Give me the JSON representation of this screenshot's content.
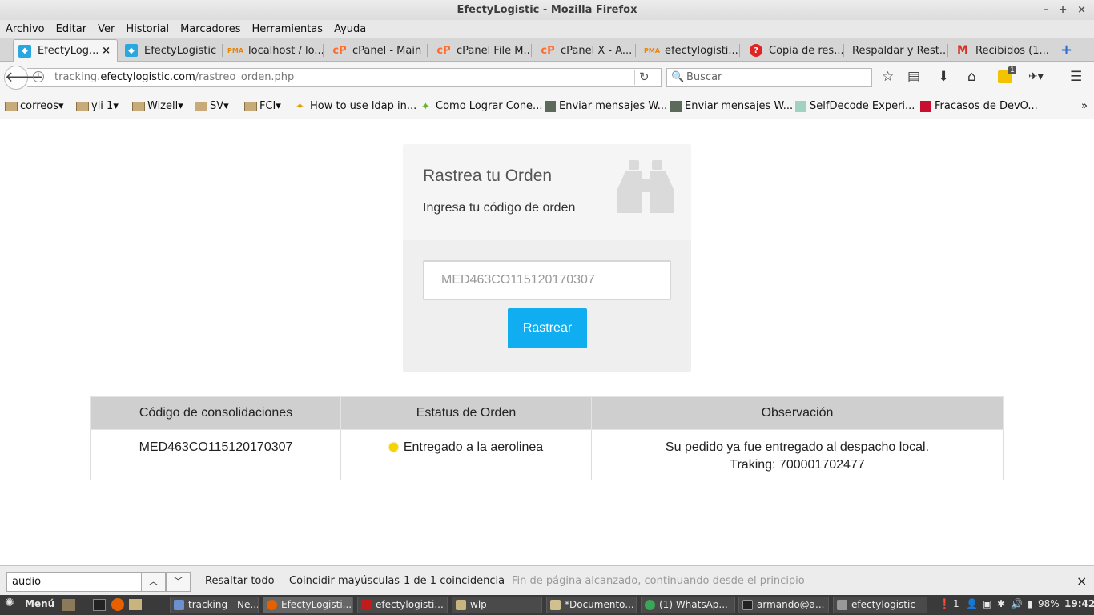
{
  "window": {
    "title": "EfectyLogistic - Mozilla Firefox",
    "controls": "– + ×"
  },
  "menu": [
    "Archivo",
    "Editar",
    "Ver",
    "Historial",
    "Marcadores",
    "Herramientas",
    "Ayuda"
  ],
  "tabs": [
    {
      "label": "EfectyLog...",
      "close": "×",
      "favicon": "efecty-favicon"
    },
    {
      "label": "EfectyLogistic",
      "favicon": "efecty-favicon"
    },
    {
      "label": "localhost / lo...",
      "favicon": "phpmyadmin-favicon"
    },
    {
      "label": "cPanel - Main",
      "favicon": "cpanel-favicon"
    },
    {
      "label": "cPanel File M...",
      "favicon": "cpanel-favicon"
    },
    {
      "label": "cPanel X - A...",
      "favicon": "cpanel-favicon"
    },
    {
      "label": "efectylogisti...",
      "favicon": "phpmyadmin-favicon"
    },
    {
      "label": "Copia de res...",
      "favicon": "help-favicon"
    },
    {
      "label": "Respaldar y Rest...",
      "favicon": ""
    },
    {
      "label": "Recibidos (1...",
      "favicon": "gmail-favicon"
    }
  ],
  "new_tab": "+",
  "nav": {
    "url_prefix": "tracking.",
    "url_host": "efectylogistic.com",
    "url_path": "/rastreo_orden.php",
    "search_placeholder": "Buscar",
    "addon_badge": "1"
  },
  "bookmarks": [
    {
      "label": "correos",
      "type": "folder"
    },
    {
      "label": "yii 1",
      "type": "folder"
    },
    {
      "label": "Wizell",
      "type": "folder"
    },
    {
      "label": "SV",
      "type": "folder"
    },
    {
      "label": "FCI",
      "type": "folder"
    },
    {
      "label": "How to use ldap in...",
      "type": "link"
    },
    {
      "label": "Como Lograr Cone...",
      "type": "link"
    },
    {
      "label": "Enviar mensajes W...",
      "type": "link"
    },
    {
      "label": "Enviar mensajes W...",
      "type": "link"
    },
    {
      "label": "SelfDecode Experi...",
      "type": "link"
    },
    {
      "label": "Fracasos de DevO...",
      "type": "link"
    }
  ],
  "bookmarks_overflow": "»",
  "card": {
    "title": "Rastrea tu Orden",
    "subtitle": "Ingresa tu código de orden",
    "input_value": "MED463CO115120170307",
    "button": "Rastrear"
  },
  "table": {
    "headers": [
      "Código de consolidaciones",
      "Estatus de Orden",
      "Observación"
    ],
    "rows": [
      {
        "code": "MED463CO115120170307",
        "status": "Entregado a la aerolinea",
        "status_color": "#f5d400",
        "observation_line1": "Su pedido ya fue entregado al despacho local.",
        "observation_line2": "Traking: 700001702477"
      }
    ]
  },
  "findbar": {
    "query": "audio",
    "highlight_all": "Resaltar todo",
    "match_case": "Coincidir mayúsculas",
    "result": "1 de 1 coincidencia",
    "wrap_notice": "Fin de página alcanzado, continuando desde el principio",
    "close": "×"
  },
  "taskbar": {
    "menu": "Menú",
    "tasks": [
      "tracking - Ne...",
      "EfectyLogisti...",
      "efectylogisti...",
      "wlp",
      "*Documento...",
      "(1) WhatsAp...",
      "armando@a...",
      "efectylogistic"
    ],
    "tray_count": "1",
    "battery": "98%",
    "clock": "19:42"
  }
}
